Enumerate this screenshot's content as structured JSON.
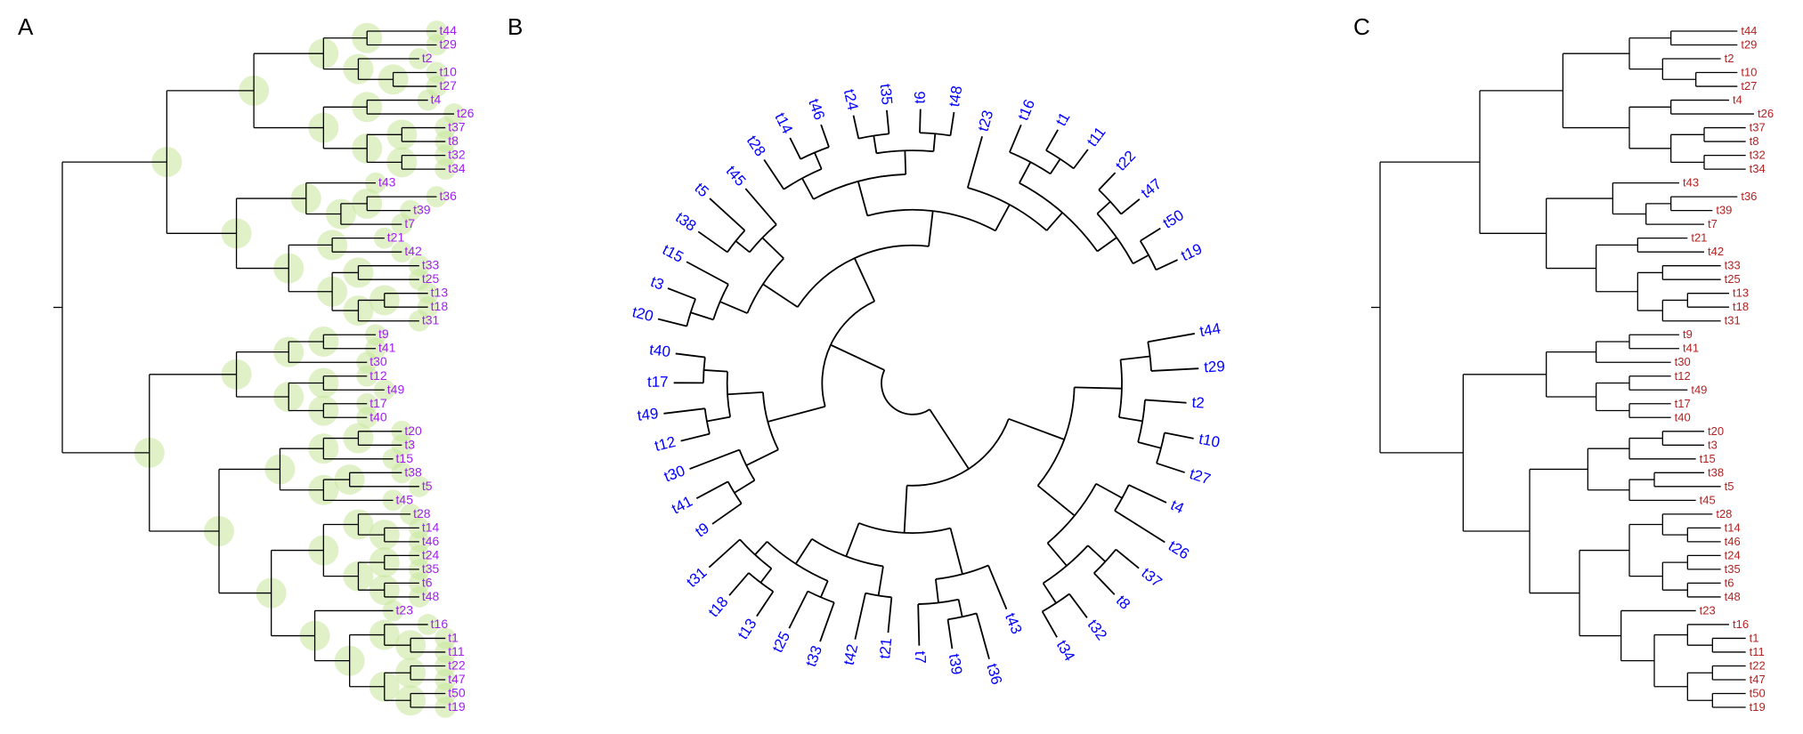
{
  "panels": {
    "A": {
      "label": "A",
      "label_color": "#a020f0",
      "node_glow_color": "#c7e59b",
      "branch_color": "#000000"
    },
    "B": {
      "label": "B",
      "label_color": "#0000ff",
      "branch_color": "#000000"
    },
    "C": {
      "label": "C",
      "label_color": "#b22222",
      "branch_color": "#000000"
    }
  },
  "chart_data": {
    "type": "phylogenetic_tree",
    "n_tips": 50,
    "tip_order": [
      "t44",
      "t29",
      "t2",
      "t10",
      "t27",
      "t4",
      "t26",
      "t37",
      "t8",
      "t32",
      "t34",
      "t43",
      "t36",
      "t39",
      "t7",
      "t21",
      "t42",
      "t33",
      "t25",
      "t13",
      "t18",
      "t31",
      "t9",
      "t41",
      "t30",
      "t12",
      "t49",
      "t17",
      "t40",
      "t20",
      "t3",
      "t15",
      "t38",
      "t5",
      "t45",
      "t28",
      "t14",
      "t46",
      "t24",
      "t35",
      "t6",
      "t48",
      "t23",
      "t16",
      "t1",
      "t11",
      "t22",
      "t47",
      "t50",
      "t19"
    ],
    "tree": {
      "children": [
        {
          "children": [
            {
              "children": [
                {
                  "children": [
                    {
                      "children": [
                        {
                          "name": "t44",
                          "len": 0.08
                        },
                        {
                          "name": "t29",
                          "len": 0.08
                        }
                      ],
                      "len": 0.05
                    },
                    {
                      "children": [
                        {
                          "name": "t2",
                          "len": 0.07
                        },
                        {
                          "children": [
                            {
                              "name": "t10",
                              "len": 0.05
                            },
                            {
                              "name": "t27",
                              "len": 0.05
                            }
                          ],
                          "len": 0.04
                        }
                      ],
                      "len": 0.04
                    }
                  ],
                  "len": 0.08
                },
                {
                  "children": [
                    {
                      "children": [
                        {
                          "name": "t4",
                          "len": 0.07
                        },
                        {
                          "name": "t26",
                          "len": 0.1
                        }
                      ],
                      "len": 0.05
                    },
                    {
                      "children": [
                        {
                          "children": [
                            {
                              "name": "t37",
                              "len": 0.05
                            },
                            {
                              "name": "t8",
                              "len": 0.05
                            }
                          ],
                          "len": 0.04
                        },
                        {
                          "children": [
                            {
                              "name": "t32",
                              "len": 0.05
                            },
                            {
                              "name": "t34",
                              "len": 0.05
                            }
                          ],
                          "len": 0.04
                        }
                      ],
                      "len": 0.05
                    }
                  ],
                  "len": 0.08
                }
              ],
              "len": 0.1
            },
            {
              "children": [
                {
                  "children": [
                    {
                      "name": "t43",
                      "len": 0.08
                    },
                    {
                      "children": [
                        {
                          "children": [
                            {
                              "name": "t36",
                              "len": 0.08
                            },
                            {
                              "name": "t39",
                              "len": 0.05
                            }
                          ],
                          "len": 0.03
                        },
                        {
                          "name": "t7",
                          "len": 0.07
                        }
                      ],
                      "len": 0.04
                    }
                  ],
                  "len": 0.08
                },
                {
                  "children": [
                    {
                      "children": [
                        {
                          "name": "t21",
                          "len": 0.06
                        },
                        {
                          "name": "t42",
                          "len": 0.08
                        }
                      ],
                      "len": 0.05
                    },
                    {
                      "children": [
                        {
                          "children": [
                            {
                              "name": "t33",
                              "len": 0.07
                            },
                            {
                              "name": "t25",
                              "len": 0.07
                            }
                          ],
                          "len": 0.03
                        },
                        {
                          "children": [
                            {
                              "children": [
                                {
                                  "name": "t13",
                                  "len": 0.05
                                },
                                {
                                  "name": "t18",
                                  "len": 0.05
                                }
                              ],
                              "len": 0.03
                            },
                            {
                              "name": "t31",
                              "len": 0.07
                            }
                          ],
                          "len": 0.03
                        }
                      ],
                      "len": 0.05
                    }
                  ],
                  "len": 0.06
                }
              ],
              "len": 0.08
            }
          ],
          "len": 0.12
        },
        {
          "children": [
            {
              "children": [
                {
                  "children": [
                    {
                      "children": [
                        {
                          "name": "t9",
                          "len": 0.06
                        },
                        {
                          "name": "t41",
                          "len": 0.06
                        }
                      ],
                      "len": 0.04
                    },
                    {
                      "name": "t30",
                      "len": 0.09
                    }
                  ],
                  "len": 0.06
                },
                {
                  "children": [
                    {
                      "children": [
                        {
                          "name": "t12",
                          "len": 0.05
                        },
                        {
                          "name": "t49",
                          "len": 0.07
                        }
                      ],
                      "len": 0.04
                    },
                    {
                      "children": [
                        {
                          "name": "t17",
                          "len": 0.05
                        },
                        {
                          "name": "t40",
                          "len": 0.05
                        }
                      ],
                      "len": 0.04
                    }
                  ],
                  "len": 0.06
                }
              ],
              "len": 0.1
            },
            {
              "children": [
                {
                  "children": [
                    {
                      "children": [
                        {
                          "children": [
                            {
                              "name": "t20",
                              "len": 0.05
                            },
                            {
                              "name": "t3",
                              "len": 0.05
                            }
                          ],
                          "len": 0.04
                        },
                        {
                          "name": "t15",
                          "len": 0.08
                        }
                      ],
                      "len": 0.05
                    },
                    {
                      "children": [
                        {
                          "children": [
                            {
                              "name": "t38",
                              "len": 0.06
                            },
                            {
                              "name": "t5",
                              "len": 0.08
                            }
                          ],
                          "len": 0.03
                        },
                        {
                          "name": "t45",
                          "len": 0.08
                        }
                      ],
                      "len": 0.05
                    }
                  ],
                  "len": 0.07
                },
                {
                  "children": [
                    {
                      "children": [
                        {
                          "children": [
                            {
                              "name": "t28",
                              "len": 0.06
                            },
                            {
                              "children": [
                                {
                                  "name": "t14",
                                  "len": 0.04
                                },
                                {
                                  "name": "t46",
                                  "len": 0.04
                                }
                              ],
                              "len": 0.03
                            }
                          ],
                          "len": 0.04
                        },
                        {
                          "children": [
                            {
                              "children": [
                                {
                                  "name": "t24",
                                  "len": 0.04
                                },
                                {
                                  "name": "t35",
                                  "len": 0.04
                                }
                              ],
                              "len": 0.03
                            },
                            {
                              "children": [
                                {
                                  "name": "t6",
                                  "len": 0.04
                                },
                                {
                                  "name": "t48",
                                  "len": 0.04
                                }
                              ],
                              "len": 0.03
                            }
                          ],
                          "len": 0.04
                        }
                      ],
                      "len": 0.06
                    },
                    {
                      "children": [
                        {
                          "name": "t23",
                          "len": 0.09
                        },
                        {
                          "children": [
                            {
                              "children": [
                                {
                                  "name": "t16",
                                  "len": 0.05
                                },
                                {
                                  "children": [
                                    {
                                      "name": "t1",
                                      "len": 0.04
                                    },
                                    {
                                      "name": "t11",
                                      "len": 0.04
                                    }
                                  ],
                                  "len": 0.03
                                }
                              ],
                              "len": 0.04
                            },
                            {
                              "children": [
                                {
                                  "children": [
                                    {
                                      "name": "t22",
                                      "len": 0.04
                                    },
                                    {
                                      "name": "t47",
                                      "len": 0.04
                                    }
                                  ],
                                  "len": 0.03
                                },
                                {
                                  "children": [
                                    {
                                      "name": "t50",
                                      "len": 0.04
                                    },
                                    {
                                      "name": "t19",
                                      "len": 0.04
                                    }
                                  ],
                                  "len": 0.03
                                }
                              ],
                              "len": 0.04
                            }
                          ],
                          "len": 0.04
                        }
                      ],
                      "len": 0.05
                    }
                  ],
                  "len": 0.06
                }
              ],
              "len": 0.08
            }
          ],
          "len": 0.1
        }
      ],
      "len": 0.0
    }
  }
}
